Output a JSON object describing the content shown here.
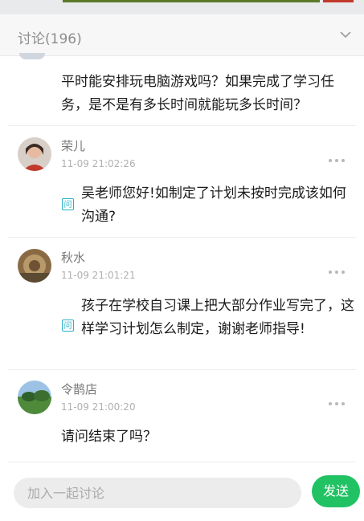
{
  "header": {
    "title": "讨论(196)"
  },
  "comments": [
    {
      "text": "平时能安排玩电脑游戏吗？如果完成了学习任务，是不是有多长时间就能玩多长时间？"
    },
    {
      "name": "荣儿",
      "time": "11-09 21:02:26",
      "badge": "问",
      "text": "吴老师您好!如制定了计划未按时完成该如何沟通?"
    },
    {
      "name": "秋水",
      "time": "11-09 21:01:21",
      "badge": "问",
      "text": "孩子在学校自习课上把大部分作业写完了，这样学习计划怎么制定，谢谢老师指导!"
    },
    {
      "name": "令鹊店",
      "time": "11-09 21:00:20",
      "text": "请问结束了吗？"
    }
  ],
  "composer": {
    "placeholder": "加入一起讨论",
    "send_label": "发送"
  },
  "icons": {
    "collapse": "chevron-down-icon",
    "more": "more-dots-icon",
    "question": "question-badge"
  },
  "colors": {
    "send_button": "#21c263",
    "badge": "#2bb0c7"
  }
}
